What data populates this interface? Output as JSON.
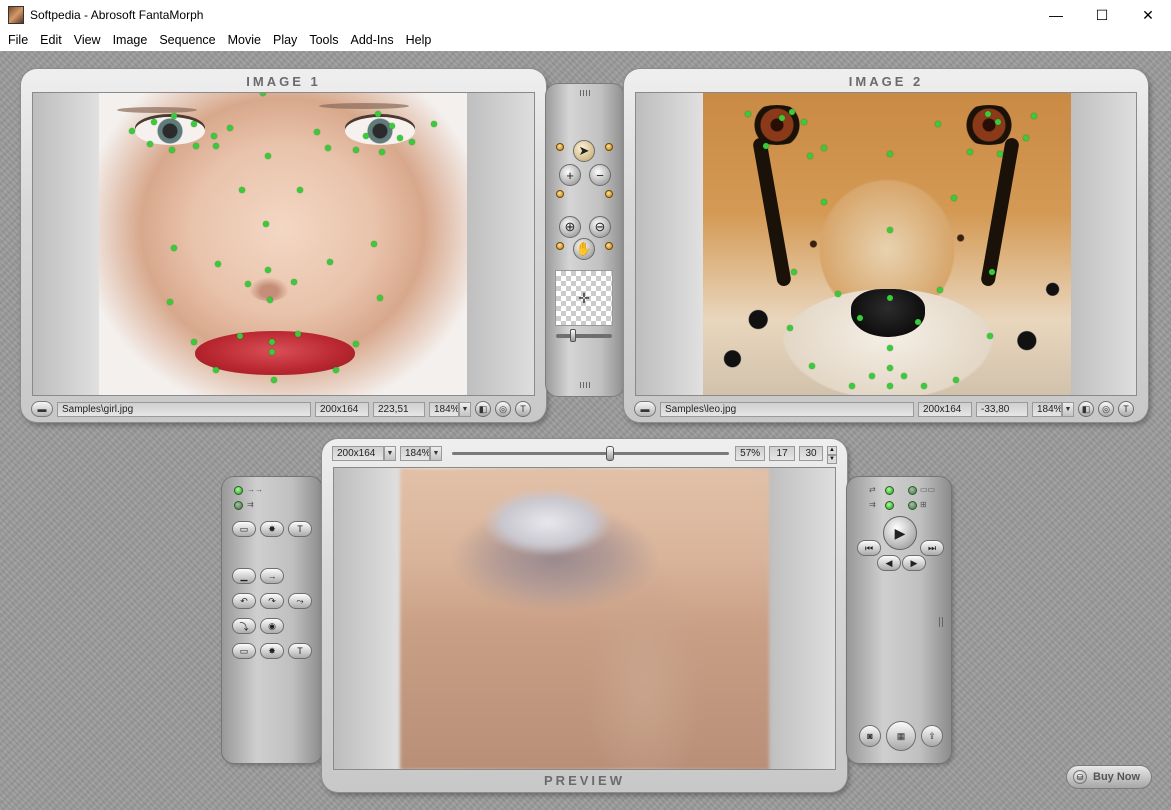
{
  "window": {
    "title": "Softpedia - Abrosoft FantaMorph",
    "minimize": "—",
    "maximize": "☐",
    "close": "✕"
  },
  "menu": [
    "File",
    "Edit",
    "View",
    "Image",
    "Sequence",
    "Movie",
    "Play",
    "Tools",
    "Add-Ins",
    "Help"
  ],
  "image1": {
    "title": "IMAGE 1",
    "file": "Samples\\girl.jpg",
    "size": "200x164",
    "coords": "223,51",
    "zoom": "184%"
  },
  "image2": {
    "title": "IMAGE 2",
    "file": "Samples\\leo.jpg",
    "size": "200x164",
    "coords": "-33,80",
    "zoom": "184%"
  },
  "preview": {
    "title": "PREVIEW",
    "size": "200x164",
    "zoom": "184%",
    "progress_label": "57%",
    "progress": 0.57,
    "frame": "17",
    "total_frames": "30"
  },
  "buy_now": "Buy Now",
  "colors": {
    "keypoint": "#3acb3a",
    "led_on": "#1e9c16",
    "panel_title": "#6b6b6b"
  },
  "icons": {
    "pointer": "pointer-icon",
    "add": "add-point-icon",
    "remove": "remove-point-icon",
    "zoom_in": "zoom-in-icon",
    "zoom_out": "zoom-out-icon",
    "hand": "hand-icon",
    "play": "play-icon",
    "first": "first-frame-icon",
    "last": "last-frame-icon",
    "prev": "prev-frame-icon",
    "next": "next-frame-icon",
    "camera": "camera-icon",
    "film": "film-icon",
    "export": "export-icon",
    "cart": "cart-icon"
  }
}
